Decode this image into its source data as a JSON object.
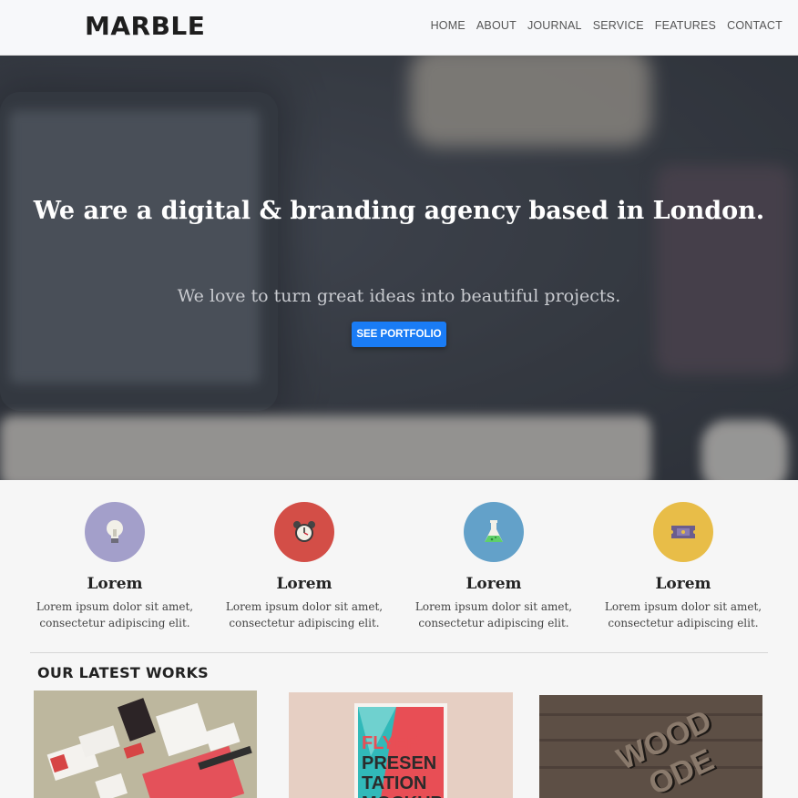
{
  "brand": {
    "name": "MARBLE"
  },
  "nav": {
    "items": [
      "HOME",
      "ABOUT",
      "JOURNAL",
      "SERVICE",
      "FEATURES",
      "CONTACT"
    ]
  },
  "hero": {
    "title": "We are a digital & branding agency based in London.",
    "subtitle": "We love to turn great ideas into beautiful projects.",
    "cta_label": "SEE PORTFOLIO"
  },
  "features": [
    {
      "icon": "lightbulb-icon",
      "color": "#a39fca",
      "title": "Lorem",
      "text_line1": "Lorem ipsum dolor sit amet,",
      "text_line2": "consectetur adipiscing elit."
    },
    {
      "icon": "alarm-clock-icon",
      "color": "#d34e47",
      "title": "Lorem",
      "text_line1": "Lorem ipsum dolor sit amet,",
      "text_line2": "consectetur adipiscing elit."
    },
    {
      "icon": "flask-icon",
      "color": "#63a1c9",
      "title": "Lorem",
      "text_line1": "Lorem ipsum dolor sit amet,",
      "text_line2": "consectetur adipiscing elit."
    },
    {
      "icon": "ticket-icon",
      "color": "#e8bd48",
      "title": "Lorem",
      "text_line1": "Lorem ipsum dolor sit amet,",
      "text_line2": "consectetur adipiscing elit."
    }
  ],
  "works": {
    "title": "OUR LATEST WORKS",
    "items": [
      {
        "name": "stationery-mockup"
      },
      {
        "name": "flyer-mockup",
        "text": "FLYER PRESEN TATION MOCKUP"
      },
      {
        "name": "wood-letters-mockup",
        "text": "WOOD"
      }
    ]
  },
  "colors": {
    "accent": "#1a7cf5",
    "header_bg": "#f7f8fa",
    "page_bg": "#f6f6f6"
  }
}
